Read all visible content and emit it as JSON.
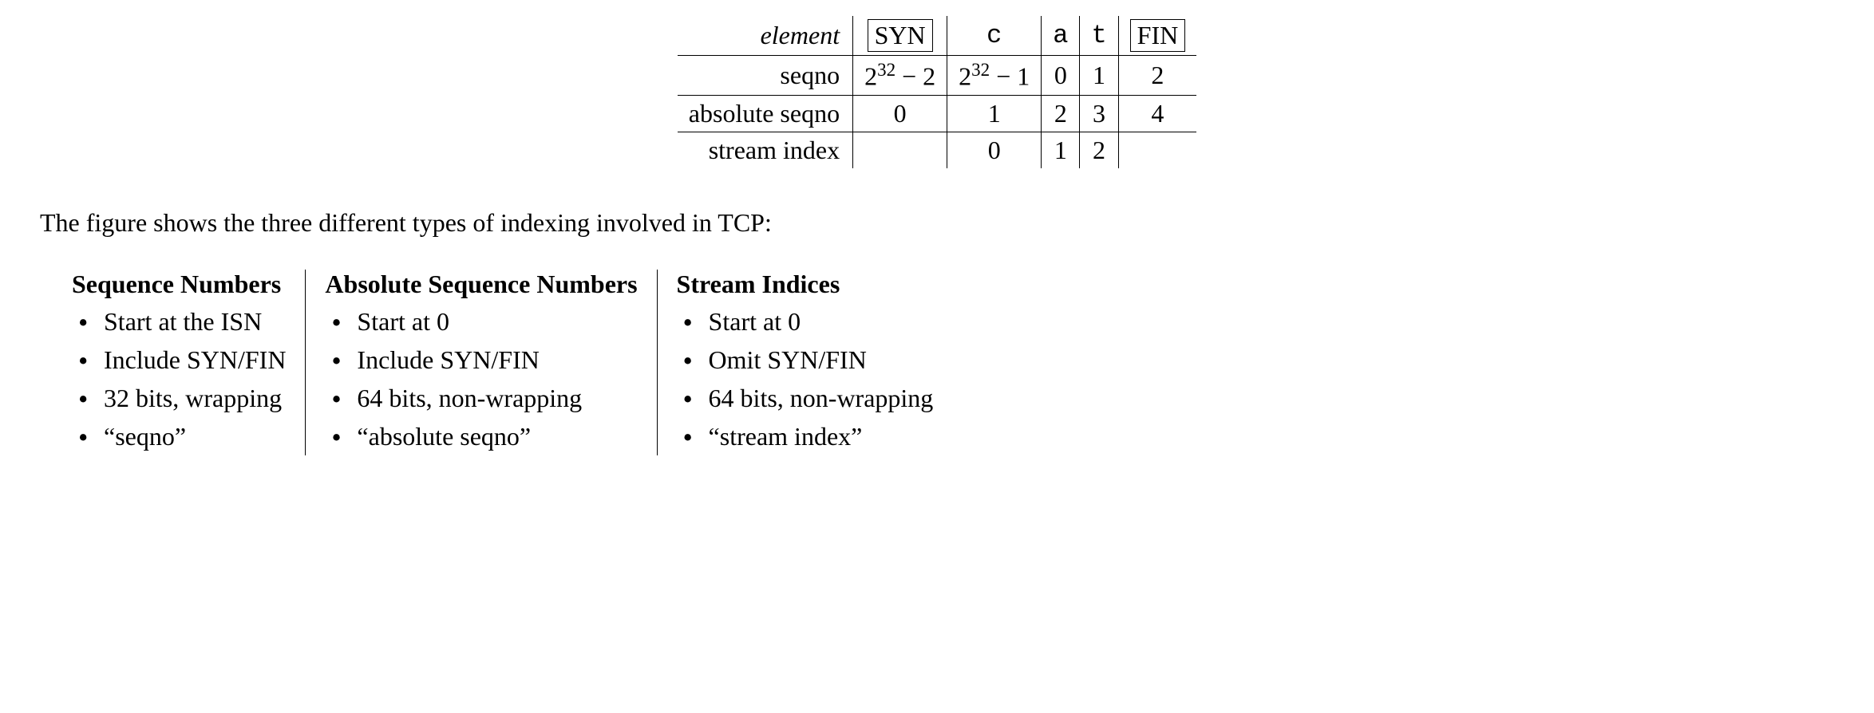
{
  "table": {
    "row_element": {
      "label": "element",
      "cells": [
        "SYN",
        "c",
        "a",
        "t",
        "FIN"
      ]
    },
    "row_seqno": {
      "label": "seqno",
      "cells": [
        "2^{32} − 2",
        "2^{32} − 1",
        "0",
        "1",
        "2"
      ]
    },
    "row_abs": {
      "label": "absolute seqno",
      "cells": [
        "0",
        "1",
        "2",
        "3",
        "4"
      ]
    },
    "row_sidx": {
      "label": "stream index",
      "cells": [
        "",
        "0",
        "1",
        "2",
        ""
      ]
    }
  },
  "caption": "The figure shows the three different types of indexing involved in TCP:",
  "columns": [
    {
      "title": "Sequence Numbers",
      "items": [
        "Start at the ISN",
        "Include SYN/FIN",
        "32 bits, wrapping",
        "“seqno”"
      ]
    },
    {
      "title": "Absolute Sequence Numbers",
      "items": [
        "Start at 0",
        "Include SYN/FIN",
        "64 bits, non-wrapping",
        "“absolute seqno”"
      ]
    },
    {
      "title": "Stream Indices",
      "items": [
        "Start at 0",
        "Omit SYN/FIN",
        "64 bits, non-wrapping",
        "“stream index”"
      ]
    }
  ]
}
